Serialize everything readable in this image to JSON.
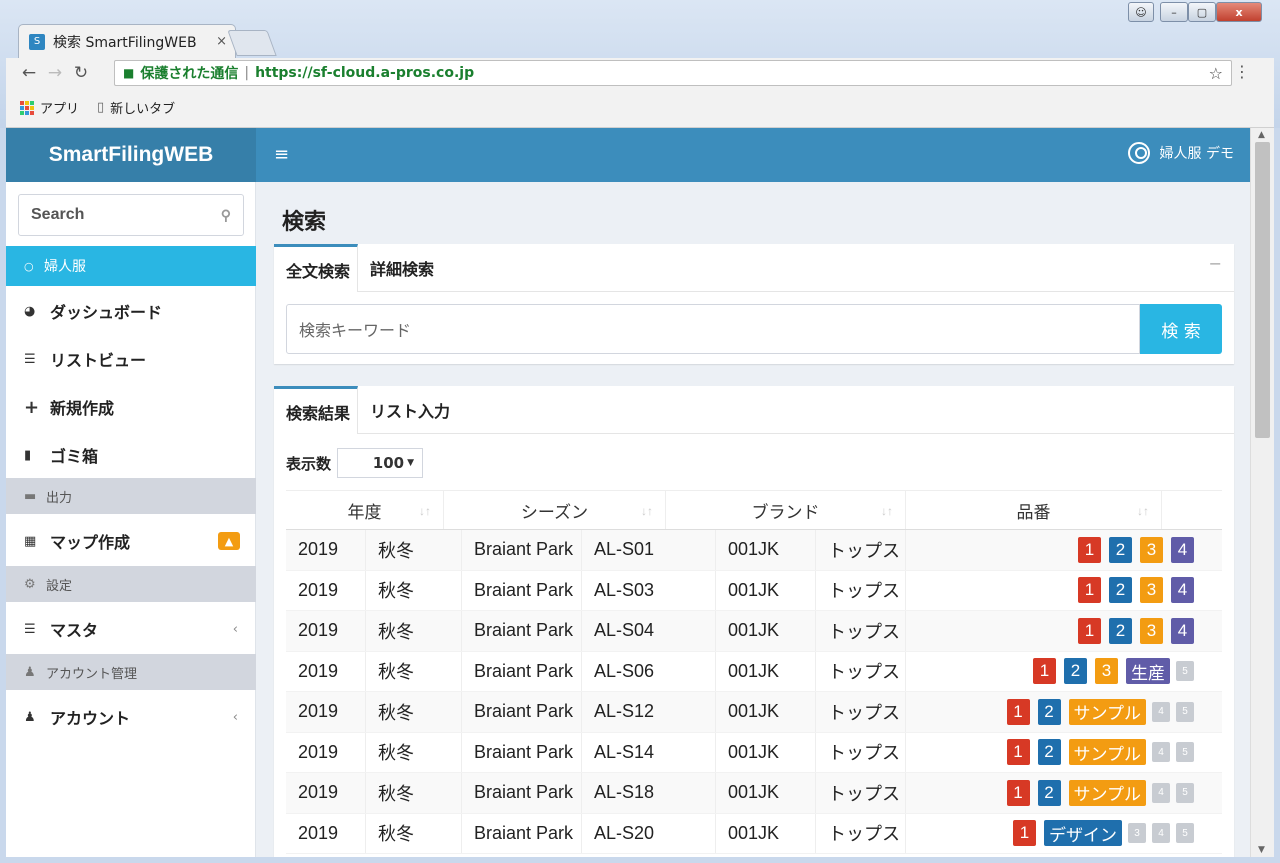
{
  "browser": {
    "tab_title": "検索 SmartFilingWEB",
    "tab_close": "×",
    "secure_label": "保護された通信",
    "url": "https://sf-cloud.a-pros.co.jp",
    "bookmarks": [
      {
        "label": "アプリ"
      },
      {
        "label": "新しいタブ"
      }
    ]
  },
  "app": {
    "logo": "SmartFilingWEB",
    "hamburger": "≡",
    "user_name": "婦人服 デモ"
  },
  "sidebar": {
    "search_placeholder": "Search",
    "active": "婦人服",
    "items": [
      {
        "label": "ダッシュボード",
        "icon": "dashboard-icon",
        "glyph": "◕"
      },
      {
        "label": "リストビュー",
        "icon": "list-icon",
        "glyph": "☰"
      },
      {
        "label": "新規作成",
        "icon": "plus-icon",
        "glyph": "+"
      },
      {
        "label": "ゴミ箱",
        "icon": "trash-icon",
        "glyph": "▮"
      }
    ],
    "output_header": "出力",
    "map_label": "マップ作成",
    "settings_header": "設定",
    "master_label": "マスタ",
    "account_header": "アカウント管理",
    "account_label": "アカウント"
  },
  "main": {
    "page_title": "検索",
    "search_tabs": [
      "全文検索",
      "詳細検索"
    ],
    "keyword_placeholder": "検索キーワード",
    "search_button": "検 索",
    "result_tabs": [
      "検索結果",
      "リスト入力"
    ],
    "show_label": "表示数",
    "show_value": "100",
    "columns": [
      "年度",
      "シーズン",
      "ブランド",
      "品番"
    ]
  },
  "rows": [
    {
      "year": "2019",
      "season": "秋冬",
      "brand": "Braiant Park",
      "code": "AL-S01",
      "item": "001JK",
      "category": "トップス",
      "tags": [
        {
          "t": "1",
          "c": "#d73925"
        },
        {
          "t": "2",
          "c": "#1f6fad"
        },
        {
          "t": "3",
          "c": "#f39c12"
        },
        {
          "t": "4",
          "c": "#605ca8"
        }
      ]
    },
    {
      "year": "2019",
      "season": "秋冬",
      "brand": "Braiant Park",
      "code": "AL-S03",
      "item": "001JK",
      "category": "トップス",
      "tags": [
        {
          "t": "1",
          "c": "#d73925"
        },
        {
          "t": "2",
          "c": "#1f6fad"
        },
        {
          "t": "3",
          "c": "#f39c12"
        },
        {
          "t": "4",
          "c": "#605ca8"
        }
      ]
    },
    {
      "year": "2019",
      "season": "秋冬",
      "brand": "Braiant Park",
      "code": "AL-S04",
      "item": "001JK",
      "category": "トップス",
      "tags": [
        {
          "t": "1",
          "c": "#d73925"
        },
        {
          "t": "2",
          "c": "#1f6fad"
        },
        {
          "t": "3",
          "c": "#f39c12"
        },
        {
          "t": "4",
          "c": "#605ca8"
        }
      ]
    },
    {
      "year": "2019",
      "season": "秋冬",
      "brand": "Braiant Park",
      "code": "AL-S06",
      "item": "001JK",
      "category": "トップス",
      "tags": [
        {
          "t": "1",
          "c": "#d73925"
        },
        {
          "t": "2",
          "c": "#1f6fad"
        },
        {
          "t": "3",
          "c": "#f39c12"
        },
        {
          "t": "生産",
          "c": "#605ca8"
        },
        {
          "t": "5",
          "c": "#c8ccd2",
          "s": true
        }
      ]
    },
    {
      "year": "2019",
      "season": "秋冬",
      "brand": "Braiant Park",
      "code": "AL-S12",
      "item": "001JK",
      "category": "トップス",
      "tags": [
        {
          "t": "1",
          "c": "#d73925"
        },
        {
          "t": "2",
          "c": "#1f6fad"
        },
        {
          "t": "サンプル",
          "c": "#f39c12"
        },
        {
          "t": "4",
          "c": "#c8ccd2",
          "s": true
        },
        {
          "t": "5",
          "c": "#c8ccd2",
          "s": true
        }
      ]
    },
    {
      "year": "2019",
      "season": "秋冬",
      "brand": "Braiant Park",
      "code": "AL-S14",
      "item": "001JK",
      "category": "トップス",
      "tags": [
        {
          "t": "1",
          "c": "#d73925"
        },
        {
          "t": "2",
          "c": "#1f6fad"
        },
        {
          "t": "サンプル",
          "c": "#f39c12"
        },
        {
          "t": "4",
          "c": "#c8ccd2",
          "s": true
        },
        {
          "t": "5",
          "c": "#c8ccd2",
          "s": true
        }
      ]
    },
    {
      "year": "2019",
      "season": "秋冬",
      "brand": "Braiant Park",
      "code": "AL-S18",
      "item": "001JK",
      "category": "トップス",
      "tags": [
        {
          "t": "1",
          "c": "#d73925"
        },
        {
          "t": "2",
          "c": "#1f6fad"
        },
        {
          "t": "サンプル",
          "c": "#f39c12"
        },
        {
          "t": "4",
          "c": "#c8ccd2",
          "s": true
        },
        {
          "t": "5",
          "c": "#c8ccd2",
          "s": true
        }
      ]
    },
    {
      "year": "2019",
      "season": "秋冬",
      "brand": "Braiant Park",
      "code": "AL-S20",
      "item": "001JK",
      "category": "トップス",
      "tags": [
        {
          "t": "1",
          "c": "#d73925"
        },
        {
          "t": "デザイン",
          "c": "#1f6fad"
        },
        {
          "t": "3",
          "c": "#c8ccd2",
          "s": true
        },
        {
          "t": "4",
          "c": "#c8ccd2",
          "s": true
        },
        {
          "t": "5",
          "c": "#c8ccd2",
          "s": true
        }
      ]
    }
  ]
}
